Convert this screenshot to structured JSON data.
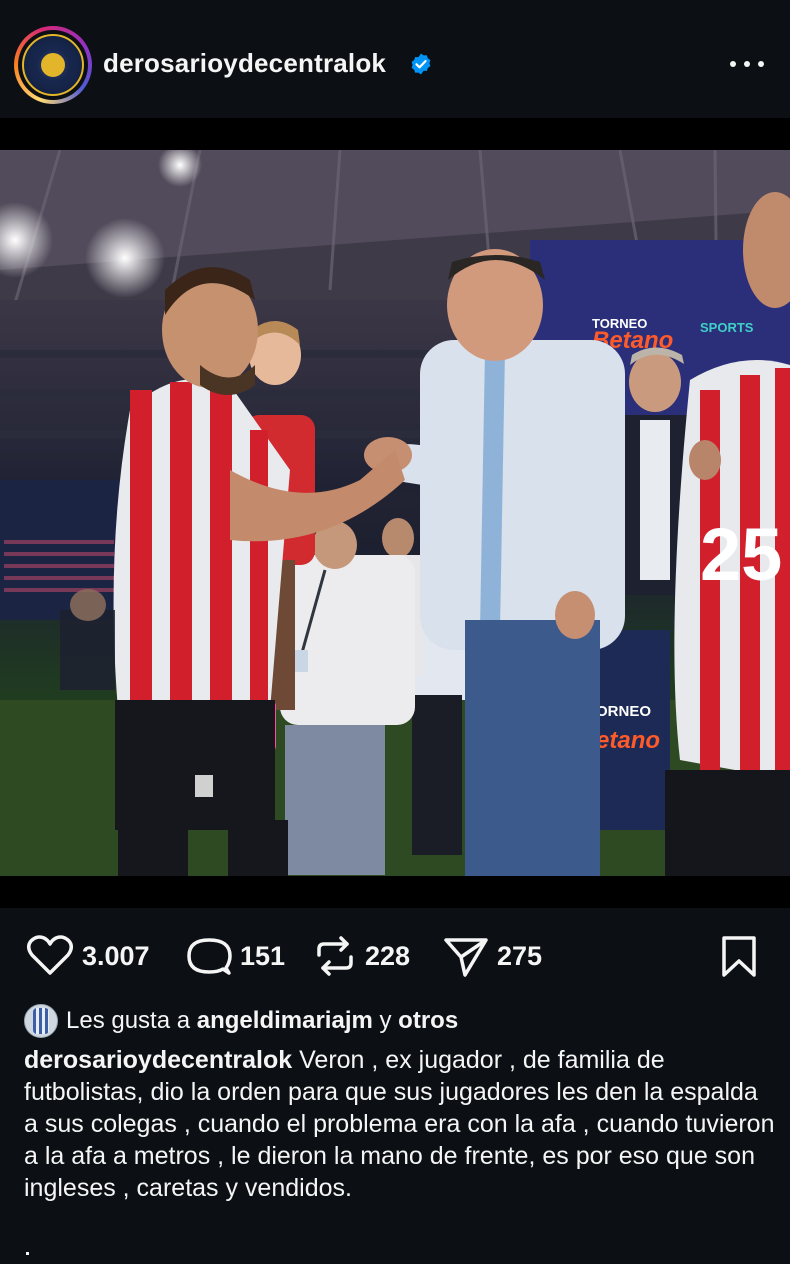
{
  "post": {
    "username": "derosarioydecentralok",
    "verified": true,
    "more_icon": "more-horizontal-icon",
    "avatar_icon": "club-crest"
  },
  "photo": {
    "description_icon": "post-photo",
    "banner_text_1": "TORNEO",
    "banner_text_2": "Betano",
    "banner_text_3": "SPORTS",
    "jersey_number": "25",
    "side_banner_1": "ORNEO",
    "side_banner_2": "etano"
  },
  "actions": {
    "likes_count": "3.007",
    "comments_count": "151",
    "reposts_count": "228",
    "shares_count": "275",
    "icons": [
      "heart-icon",
      "comment-icon",
      "repost-icon",
      "share-icon",
      "bookmark-icon"
    ]
  },
  "liked_by": {
    "prefix": "Les gusta a ",
    "user": "angeldimariajm",
    "connector": " y ",
    "others": "otros"
  },
  "caption": {
    "username": "derosarioydecentralok",
    "text": " Veron , ex jugador , de familia de futbolistas,  dio la orden para que sus jugadores les den la espalda a sus colegas , cuando el problema era con la afa , cuando tuvieron a la afa a metros , le dieron la mano de frente,  es por eso que son ingleses , caretas y vendidos."
  },
  "colors": {
    "background": "#0c1014",
    "text": "#f5f5f5",
    "verified": "#0095f6"
  }
}
